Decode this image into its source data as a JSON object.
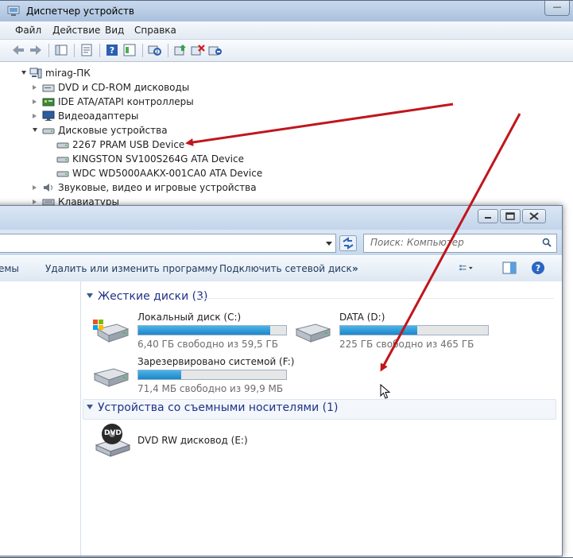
{
  "device_manager": {
    "title": "Диспетчер устройств",
    "min_button": "—",
    "menu": [
      "Файл",
      "Действие",
      "Вид",
      "Справка"
    ],
    "tree": [
      {
        "label": "mirag-ПК",
        "state": "expanded",
        "icon": "computer-icon"
      },
      {
        "label": "DVD и CD-ROM дисководы",
        "state": "collapsed",
        "icon": "dvd-drive-icon"
      },
      {
        "label": "IDE ATA/ATAPI контроллеры",
        "state": "collapsed",
        "icon": "controller-icon"
      },
      {
        "label": "Видеоадаптеры",
        "state": "collapsed",
        "icon": "monitor-icon"
      },
      {
        "label": "Дисковые устройства",
        "state": "expanded",
        "icon": "disk-drive-icon"
      },
      {
        "label": "2267 PRAM USB Device",
        "state": "leaf",
        "icon": "disk-drive-icon"
      },
      {
        "label": "KINGSTON SV100S264G ATA Device",
        "state": "leaf",
        "icon": "disk-drive-icon"
      },
      {
        "label": "WDC WD5000AAKX-001CA0 ATA Device",
        "state": "leaf",
        "icon": "disk-drive-icon"
      },
      {
        "label": "Звуковые, видео и игровые устройства",
        "state": "collapsed",
        "icon": "speaker-icon"
      },
      {
        "label": "Клавиатуры",
        "state": "collapsed",
        "icon": "keyboard-icon"
      }
    ]
  },
  "explorer": {
    "search_placeholder": "Поиск: Компьютер",
    "commands": {
      "partial": "темы",
      "uninstall": "Удалить или изменить программу",
      "map_drive": "Подключить сетевой диск",
      "more": "»"
    },
    "groups": {
      "hard_disks": "Жесткие диски (3)",
      "removable": "Устройства со съемными носителями (1)"
    },
    "drives": [
      {
        "name": "Локальный диск (C:)",
        "free": "6,40 ГБ свободно из 59,5 ГБ",
        "used_fraction": 0.89
      },
      {
        "name": "DATA (D:)",
        "free": "225 ГБ свободно из 465 ГБ",
        "used_fraction": 0.52
      },
      {
        "name": "Зарезервировано системой (F:)",
        "free": "71,4 МБ свободно из 99,9 МБ",
        "used_fraction": 0.29
      }
    ],
    "dvd": {
      "name": "DVD RW дисковод (E:)",
      "badge": "DVD"
    }
  },
  "colors": {
    "arrow": "#c0161c",
    "bar_fill": "#26a0da",
    "group_text": "#1e3287"
  }
}
